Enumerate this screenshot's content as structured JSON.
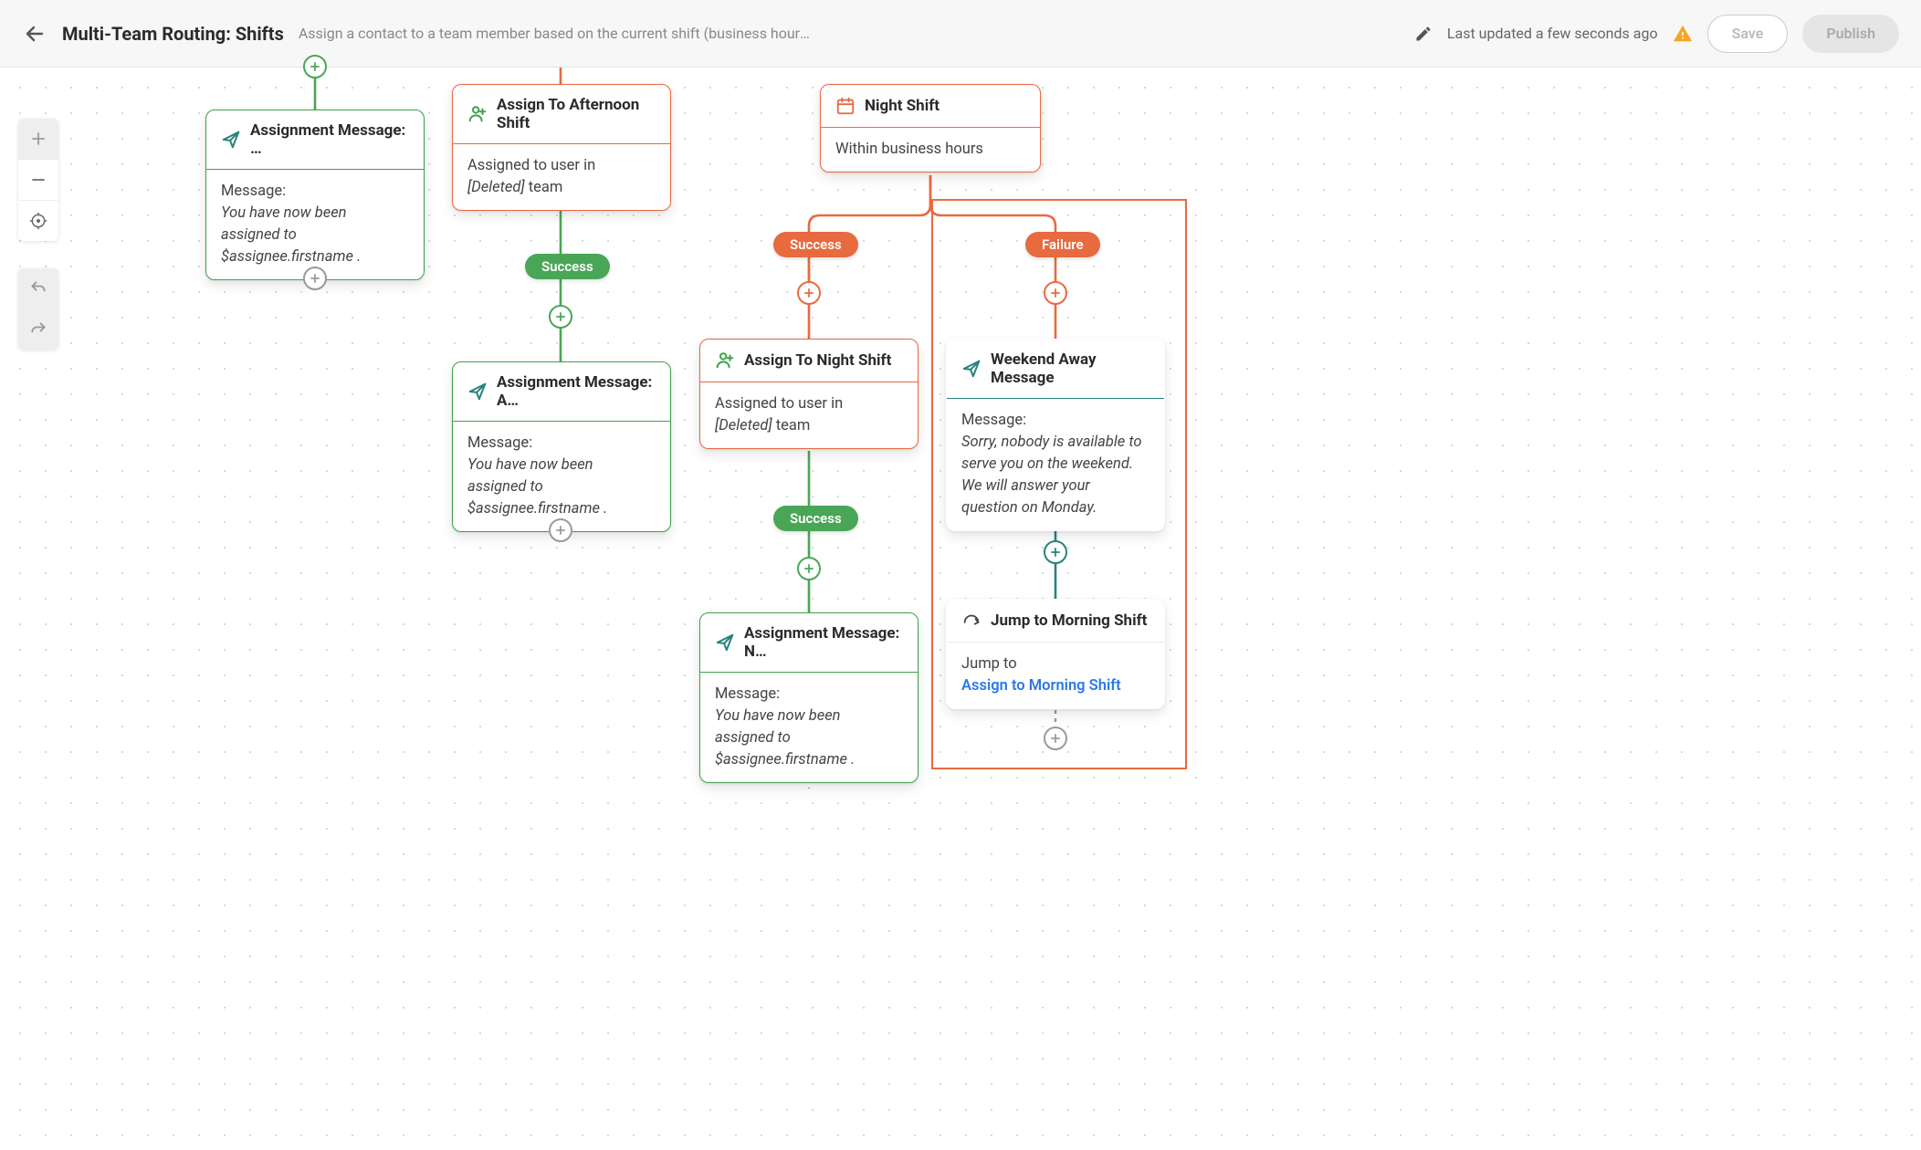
{
  "header": {
    "title": "Multi-Team Routing: Shifts",
    "subtitle": "Assign a contact to a team member based on the current shift (business hours…",
    "updated": "Last updated a few seconds ago",
    "save_label": "Save",
    "publish_label": "Publish"
  },
  "pills": {
    "success": "Success",
    "failure": "Failure"
  },
  "nodes": {
    "assignment_msg_1": {
      "title": "Assignment Message: …",
      "msg_label": "Message:",
      "msg_body": "You have now been assigned to $assignee.firstname ."
    },
    "assign_afternoon": {
      "title": "Assign To Afternoon Shift",
      "body_prefix": "Assigned to user in ",
      "deleted": "[Deleted]",
      "body_suffix": " team"
    },
    "night_shift": {
      "title": "Night Shift",
      "body": "Within business hours"
    },
    "assignment_msg_2": {
      "title": "Assignment Message: A…",
      "msg_label": "Message:",
      "msg_body": "You have now been assigned to $assignee.firstname ."
    },
    "assign_night": {
      "title": "Assign To Night Shift",
      "body_prefix": "Assigned to user in ",
      "deleted": "[Deleted]",
      "body_suffix": " team"
    },
    "weekend_away": {
      "title": "Weekend Away Message",
      "msg_label": "Message:",
      "msg_body": "Sorry, nobody is available to serve you on the weekend. We will answer your question on Monday."
    },
    "assignment_msg_3": {
      "title": "Assignment Message: N…",
      "msg_label": "Message:",
      "msg_body": "You have now been assigned to $assignee.firstname ."
    },
    "jump_morning": {
      "title": "Jump to Morning Shift",
      "label": "Jump to",
      "link": "Assign to Morning Shift"
    }
  },
  "colors": {
    "green": "#4aa657",
    "orange": "#e86a3f",
    "teal": "#27827d",
    "gray": "#9a9a9a"
  }
}
